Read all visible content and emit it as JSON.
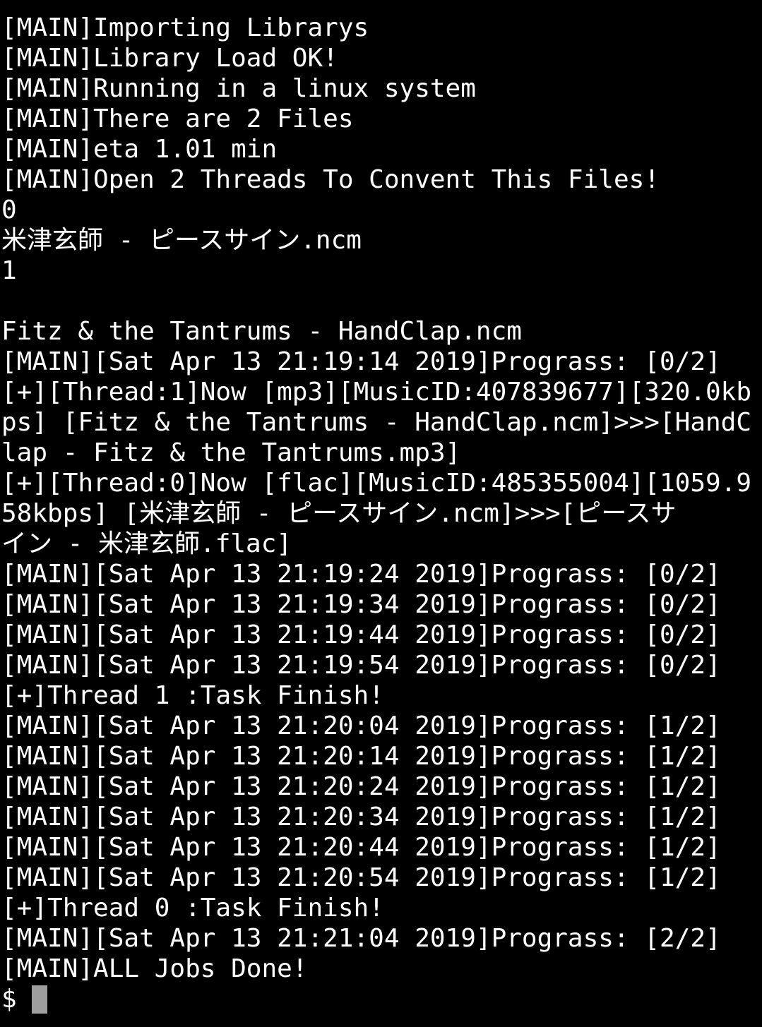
{
  "terminal": {
    "lines": [
      "[MAIN]Importing Librarys",
      "[MAIN]Library Load OK!",
      "[MAIN]Running in a linux system",
      "[MAIN]There are 2 Files",
      "[MAIN]eta 1.01 min",
      "[MAIN]Open 2 Threads To Convent This Files!",
      "0",
      "米津玄師 - ピースサイン.ncm",
      "1",
      "",
      "Fitz & the Tantrums - HandClap.ncm",
      "[MAIN][Sat Apr 13 21:19:14 2019]Prograss: [0/2]",
      "[+][Thread:1]Now [mp3][MusicID:407839677][320.0kb",
      "ps] [Fitz & the Tantrums - HandClap.ncm]>>>[HandC",
      "lap - Fitz & the Tantrums.mp3]",
      "[+][Thread:0]Now [flac][MusicID:485355004][1059.9",
      "58kbps] [米津玄師 - ピースサイン.ncm]>>>[ピースサ",
      "イン - 米津玄師.flac]",
      "[MAIN][Sat Apr 13 21:19:24 2019]Prograss: [0/2]",
      "[MAIN][Sat Apr 13 21:19:34 2019]Prograss: [0/2]",
      "[MAIN][Sat Apr 13 21:19:44 2019]Prograss: [0/2]",
      "[MAIN][Sat Apr 13 21:19:54 2019]Prograss: [0/2]",
      "[+]Thread 1 :Task Finish!",
      "[MAIN][Sat Apr 13 21:20:04 2019]Prograss: [1/2]",
      "[MAIN][Sat Apr 13 21:20:14 2019]Prograss: [1/2]",
      "[MAIN][Sat Apr 13 21:20:24 2019]Prograss: [1/2]",
      "[MAIN][Sat Apr 13 21:20:34 2019]Prograss: [1/2]",
      "[MAIN][Sat Apr 13 21:20:44 2019]Prograss: [1/2]",
      "[MAIN][Sat Apr 13 21:20:54 2019]Prograss: [1/2]",
      "[+]Thread 0 :Task Finish!",
      "[MAIN][Sat Apr 13 21:21:04 2019]Prograss: [2/2]",
      "[MAIN]ALL Jobs Done!"
    ],
    "prompt": "$ ",
    "colors": {
      "background": "#000000",
      "text": "#ffffff",
      "cursor": "#9e9e9e"
    }
  }
}
